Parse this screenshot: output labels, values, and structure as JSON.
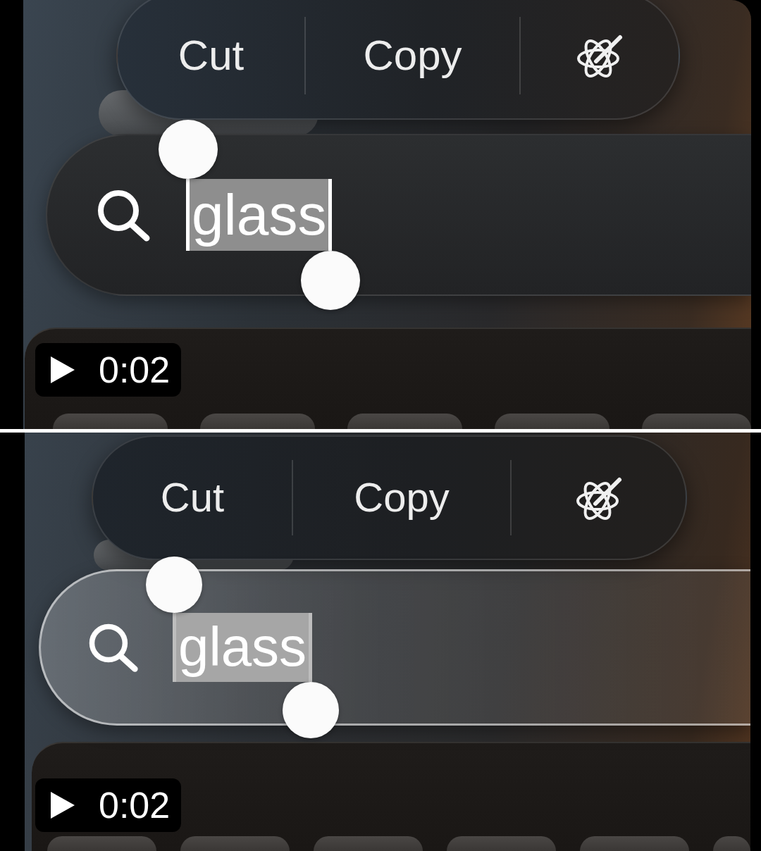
{
  "videos": [
    {
      "menu": [
        {
          "kind": "text",
          "label": "Cut"
        },
        {
          "kind": "text",
          "label": "Copy"
        },
        {
          "kind": "icon"
        }
      ],
      "search": {
        "kind": "tinted",
        "value": "glass",
        "selected": true
      },
      "duration": "0:02"
    },
    {
      "menu": [
        {
          "kind": "text",
          "label": "Cut"
        },
        {
          "kind": "text",
          "label": "Copy"
        },
        {
          "kind": "icon"
        }
      ],
      "search": {
        "kind": "clear",
        "value": "glass",
        "selected": true
      },
      "duration": "0:02"
    }
  ]
}
